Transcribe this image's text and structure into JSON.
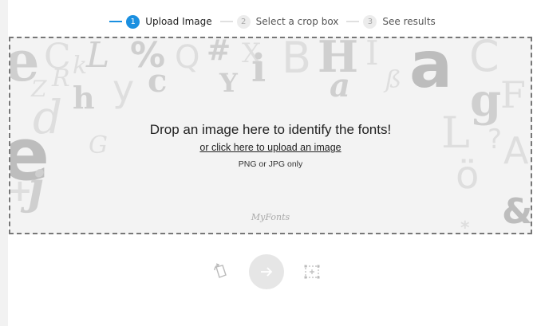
{
  "steps": [
    {
      "number": "1",
      "label": "Upload Image",
      "active": true
    },
    {
      "number": "2",
      "label": "Select a crop box",
      "active": false
    },
    {
      "number": "3",
      "label": "See results",
      "active": false
    }
  ],
  "dropzone": {
    "title": "Drop an image here to identify the fonts!",
    "link": "or click here to upload an image",
    "note": "PNG or JPG only",
    "logo_text": "MyFonts"
  },
  "decor_glyphs": [
    "e",
    "C",
    "k",
    "L",
    "%",
    "Q",
    "#",
    "X",
    "i",
    "B",
    "H",
    "I",
    "a",
    "C",
    "Z",
    "R",
    "h",
    "y",
    "c",
    "Y",
    "a",
    "ß",
    "d",
    "G",
    "e",
    "j",
    "+",
    "L",
    "g",
    "F",
    "?",
    "A",
    "ö",
    "&",
    "*"
  ],
  "toolbar": {
    "rotate_icon": "rotate-icon",
    "next_icon": "arrow-right-icon",
    "crop_icon": "crop-box-icon"
  },
  "colors": {
    "accent": "#1a8fe0",
    "dropzone_bg": "#f3f3f3",
    "border": "#777777"
  }
}
